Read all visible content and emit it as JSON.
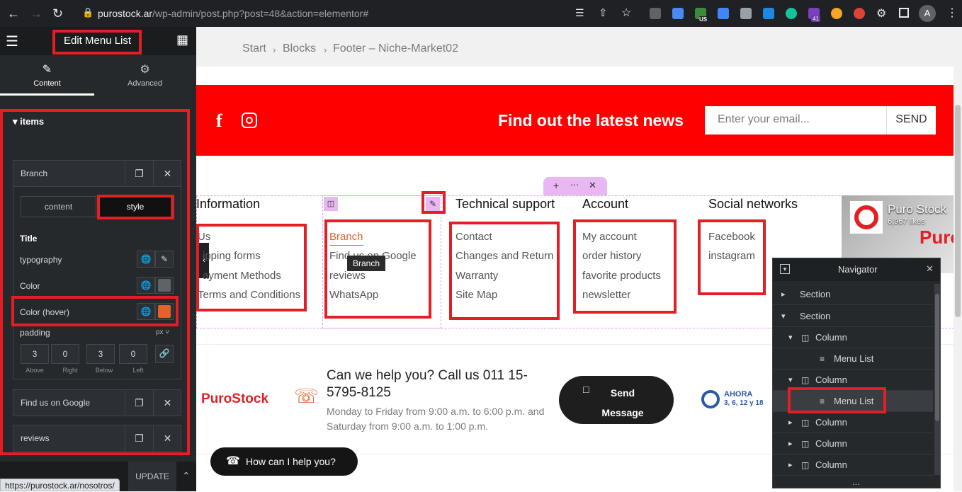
{
  "browser": {
    "url_host": "purostock.ar",
    "url_path": "/wp-admin/post.php?post=48&action=elementor#",
    "ext_badge_count": "41",
    "ext_region_badge": "US",
    "profile_initial": "A"
  },
  "sidebar": {
    "title": "Edit Menu List",
    "tabs": [
      {
        "label": "Content"
      },
      {
        "label": "Advanced"
      }
    ],
    "section_heading": "items",
    "repeater_items": [
      {
        "label": "Branch"
      },
      {
        "label": "Find us on Google"
      },
      {
        "label": "reviews"
      }
    ],
    "inner_tabs": [
      "content",
      "style"
    ],
    "style": {
      "group_title": "Title",
      "typography_label": "typography",
      "color_label": "Color",
      "color_hover_label": "Color (hover)",
      "color_value": "#5f6266",
      "color_hover_value": "#e2622b",
      "padding_label": "padding",
      "padding_unit": "px",
      "padding_values": [
        "3",
        "0",
        "3",
        "0"
      ],
      "padding_captions": [
        "Above",
        "Right",
        "Below",
        "Left"
      ]
    },
    "update_label": "UPDATE"
  },
  "status_url": "https://purostock.ar/nosotros/",
  "canvas": {
    "breadcrumb": [
      "Start",
      "Blocks",
      "Footer – Niche-Market02"
    ],
    "news_title": "Find out the latest news",
    "email_placeholder": "Enter your email...",
    "send_label": "SEND",
    "columns": [
      {
        "heading": "Information",
        "links": [
          "Us",
          "ipping forms",
          "ayment Methods",
          "Terms and Conditions"
        ]
      },
      {
        "heading": "",
        "links": [
          "Branch",
          "Find us on Google",
          "reviews",
          "WhatsApp"
        ]
      },
      {
        "heading": "Technical support",
        "links": [
          "Contact",
          "Changes and Return",
          "Warranty",
          "Site Map"
        ]
      },
      {
        "heading": "Account",
        "links": [
          "My account",
          "order history",
          "favorite products",
          "newsletter"
        ]
      },
      {
        "heading": "Social networks",
        "links": [
          "Facebook",
          "instagram"
        ]
      }
    ],
    "tooltip": "Branch",
    "fb_widget": {
      "name": "Puro Stock",
      "likes": "6,967 likes",
      "banner_text": "Puro"
    },
    "help_title": "Can we help you? Call us 011 15-5795-8125",
    "help_hours": "Monday to Friday from 9:00 a.m. to 6:00 p.m. and Saturday from 9:00 a.m. to 1:00 p.m.",
    "send_message_label": "Send Message",
    "brand_logo": "PuroStock",
    "ahora_label": "AHORA",
    "ahora_sub": "3, 6, 12 y 18",
    "chat_label": "How can I help you?",
    "accent_red": "#fe0000",
    "link_active_color": "#e2622b"
  },
  "navigator": {
    "title": "Navigator",
    "rows": [
      {
        "label": "Section",
        "kind": "section",
        "collapsed": true
      },
      {
        "label": "Section",
        "kind": "section",
        "collapsed": false
      },
      {
        "label": "Column",
        "kind": "column",
        "collapsed": false
      },
      {
        "label": "Menu List",
        "kind": "widget"
      },
      {
        "label": "Column",
        "kind": "column",
        "collapsed": false
      },
      {
        "label": "Menu List",
        "kind": "widget",
        "selected": true
      },
      {
        "label": "Column",
        "kind": "column",
        "collapsed": true
      },
      {
        "label": "Column",
        "kind": "column",
        "collapsed": true
      },
      {
        "label": "Column",
        "kind": "column",
        "collapsed": true
      }
    ],
    "more": "..."
  }
}
